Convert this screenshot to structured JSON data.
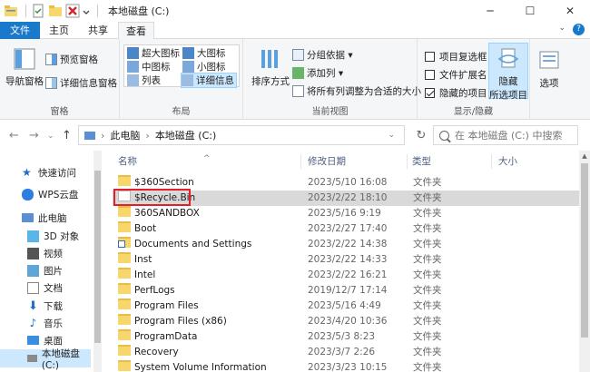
{
  "window": {
    "title": "本地磁盘 (C:)",
    "controls": [
      "minimize",
      "maximize",
      "close"
    ]
  },
  "tabs": {
    "file": "文件",
    "home": "主页",
    "share": "共享",
    "view": "查看",
    "active": "查看"
  },
  "ribbon": {
    "panes": {
      "group_label": "窗格",
      "nav_pane": "导航窗格",
      "preview_pane": "预览窗格",
      "details_pane": "详细信息窗格"
    },
    "layout": {
      "group_label": "布局",
      "extra_large": "超大图标",
      "large": "大图标",
      "medium": "中图标",
      "small": "小图标",
      "list": "列表",
      "details": "详细信息",
      "selected": "详细信息"
    },
    "current_view": {
      "group_label": "当前视图",
      "sort": "排序方式",
      "group_by": "分组依据",
      "add_column": "添加列",
      "fit_columns": "将所有列调整为合适的大小"
    },
    "show_hide": {
      "group_label": "显示/隐藏",
      "item_checkbox": {
        "label": "项目复选框",
        "checked": false
      },
      "file_extensions": {
        "label": "文件扩展名",
        "checked": false
      },
      "hidden_items": {
        "label": "隐藏的项目",
        "checked": true
      },
      "hide_selected": "隐藏",
      "hide_selected_2": "所选项目"
    },
    "options": "选项"
  },
  "address": {
    "path": [
      "此电脑",
      "本地磁盘 (C:)"
    ],
    "search_placeholder": "在 本地磁盘 (C:) 中搜索"
  },
  "nav_pane": {
    "items": [
      {
        "label": "快速访问",
        "icon": "star-icon",
        "selected": false
      },
      {
        "label": "WPS云盘",
        "icon": "cloud-icon",
        "selected": false
      },
      {
        "label": "此电脑",
        "icon": "computer-icon",
        "selected": false
      },
      {
        "label": "3D 对象",
        "icon": "cube-icon",
        "selected": false
      },
      {
        "label": "视频",
        "icon": "video-icon",
        "selected": false
      },
      {
        "label": "图片",
        "icon": "picture-icon",
        "selected": false
      },
      {
        "label": "文档",
        "icon": "document-icon",
        "selected": false
      },
      {
        "label": "下载",
        "icon": "download-icon",
        "selected": false
      },
      {
        "label": "音乐",
        "icon": "music-icon",
        "selected": false
      },
      {
        "label": "桌面",
        "icon": "desktop-icon",
        "selected": false
      },
      {
        "label": "本地磁盘 (C:)",
        "icon": "drive-icon",
        "selected": true
      }
    ]
  },
  "file_list": {
    "columns": {
      "name": "名称",
      "date": "修改日期",
      "type": "类型",
      "size": "大小"
    },
    "rows": [
      {
        "name": "$360Section",
        "date": "2023/5/10 16:08",
        "type": "文件夹",
        "icon": "folder-icon"
      },
      {
        "name": "$Recycle.Bin",
        "date": "2023/2/22 18:10",
        "type": "文件夹",
        "icon": "recycle-bin-icon",
        "selected": true
      },
      {
        "name": "360SANDBOX",
        "date": "2023/5/16 9:19",
        "type": "文件夹",
        "icon": "folder-icon"
      },
      {
        "name": "Boot",
        "date": "2023/2/27 17:40",
        "type": "文件夹",
        "icon": "folder-icon"
      },
      {
        "name": "Documents and Settings",
        "date": "2023/2/22 14:38",
        "type": "文件夹",
        "icon": "shortcut-folder-icon"
      },
      {
        "name": "Inst",
        "date": "2023/2/22 14:33",
        "type": "文件夹",
        "icon": "folder-icon"
      },
      {
        "name": "Intel",
        "date": "2023/2/22 16:21",
        "type": "文件夹",
        "icon": "folder-icon"
      },
      {
        "name": "PerfLogs",
        "date": "2019/12/7 17:14",
        "type": "文件夹",
        "icon": "folder-icon"
      },
      {
        "name": "Program Files",
        "date": "2023/5/16 4:49",
        "type": "文件夹",
        "icon": "folder-icon"
      },
      {
        "name": "Program Files (x86)",
        "date": "2023/4/20 10:36",
        "type": "文件夹",
        "icon": "folder-icon"
      },
      {
        "name": "ProgramData",
        "date": "2023/5/3 8:23",
        "type": "文件夹",
        "icon": "folder-icon"
      },
      {
        "name": "Recovery",
        "date": "2023/3/7 2:26",
        "type": "文件夹",
        "icon": "folder-icon"
      },
      {
        "name": "System Volume Information",
        "date": "2023/3/23 10:15",
        "type": "文件夹",
        "icon": "folder-icon"
      }
    ]
  },
  "colors": {
    "accent": "#1979ca",
    "selection": "#cce8ff",
    "highlight_border": "#e0202a"
  }
}
